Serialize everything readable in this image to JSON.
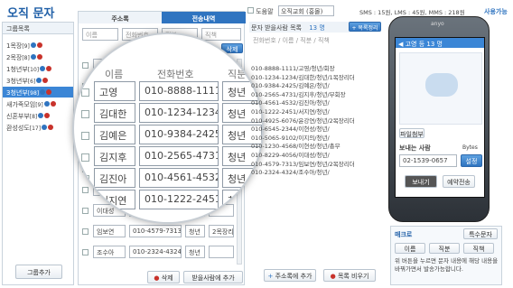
{
  "app": {
    "title": "오직 문자"
  },
  "groups": {
    "header": "그룹목록",
    "items": [
      {
        "label": "1목장",
        "count": "[9]"
      },
      {
        "label": "2목장",
        "count": "[8]"
      },
      {
        "label": "1청년부",
        "count": "[10]"
      },
      {
        "label": "3청년부",
        "count": "[6]"
      },
      {
        "label": "3청년부",
        "count": "[98]"
      },
      {
        "label": "새가족모임",
        "count": "[9]"
      },
      {
        "label": "신혼부부",
        "count": "[8]"
      },
      {
        "label": "환성성도",
        "count": "[17]"
      }
    ],
    "add_button": "그룹추가"
  },
  "contacts": {
    "tab_address": "주소록",
    "tab_history": "전송내역",
    "search_fields": [
      "이름",
      "전화번호",
      "직분",
      "직책"
    ],
    "add_label": "추가",
    "delete_label": "삭제",
    "columns": [
      "이름",
      "전화번호",
      "직분"
    ],
    "rows": [
      {
        "name": "고영",
        "phone": "010-8888-1111",
        "role": "청년",
        "title": ""
      },
      {
        "name": "김대한",
        "phone": "010-1234-1234",
        "role": "청년",
        "title": ""
      },
      {
        "name": "김예은",
        "phone": "010-9384-2425",
        "role": "청년",
        "title": ""
      },
      {
        "name": "김지후",
        "phone": "010-2565-4731",
        "role": "청년",
        "title": ""
      },
      {
        "name": "김진아",
        "phone": "010-4561-4532",
        "role": "청년",
        "title": ""
      },
      {
        "name": "서지연",
        "phone": "010-1222-2451",
        "role": "청년",
        "title": ""
      },
      {
        "name": "이현성",
        "phone": "010-1230-4568",
        "role": "청년",
        "title": "총무"
      },
      {
        "name": "이대성",
        "phone": "010-8229-4056",
        "role": "청년",
        "title": ""
      },
      {
        "name": "임보연",
        "phone": "010-4579-7313",
        "role": "청년",
        "title": "2목장리더"
      },
      {
        "name": "조수아",
        "phone": "010-2324-4324",
        "role": "청년",
        "title": ""
      }
    ],
    "delete_button": "삭제",
    "add_to_list_button": "받을사람에 추가"
  },
  "recipients": {
    "auto_checkbox": "도움말",
    "sender_select": "오직교회 (홍몰)",
    "sms_info": "SMS : 15원, LMS : 45원, MMS : 218원",
    "usage_link": "사용가능",
    "list_title": "문자 받을사람 목록",
    "count": "13 명",
    "columns": [
      "전화번호",
      "이름",
      "직분",
      "직책"
    ],
    "add_addr_button": "+ 목록정리",
    "lines": [
      "010-8888-1111/고영/청년/회장",
      "010-1234-1234/김대한/청년/1목장리더",
      "010-9384-2425/김예은/청년/",
      "010-2565-4731/김지후/청년/부회장",
      "010-4561-4532/김진아/청년/",
      "010-1222-2451/서지연/청년/",
      "010-4925-6076/윤강연/청년/2목장리더",
      "010-6545-2344/이현성/청년/",
      "010-5065-9102/이지의/청년/",
      "010-1230-4568/이현성/청년/총무",
      "010-8229-4056/이대성/청년/",
      "010-4579-7313/임보연/청년/2목장리더",
      "010-2324-4324/조수아/청년/"
    ],
    "addr_add_button": "주소록에 추가",
    "clear_button": "목록 비우기"
  },
  "phone": {
    "brand": "anyo",
    "chat_title": "고영 등 13 명",
    "attach_button": "파일첨부",
    "sender_label": "보내는 사람",
    "bytes_label": "Bytes",
    "sender_number": "02-1539-0657",
    "set_button": "설정",
    "send_button": "보내기",
    "reserve_button": "예약전송"
  },
  "macro": {
    "title": "매크로",
    "special_button": "특수문자",
    "chips": [
      "이름",
      "직분",
      "직책"
    ],
    "help": "위 버튼을 누르면 문자 내용에 해당 내용을 바꿔가면서 발송가능합니다."
  },
  "colors": {
    "accent": "#2f74c0",
    "brand_title": "#1f5fa7",
    "selected": "#3b86d6",
    "delete": "#c8322b"
  }
}
